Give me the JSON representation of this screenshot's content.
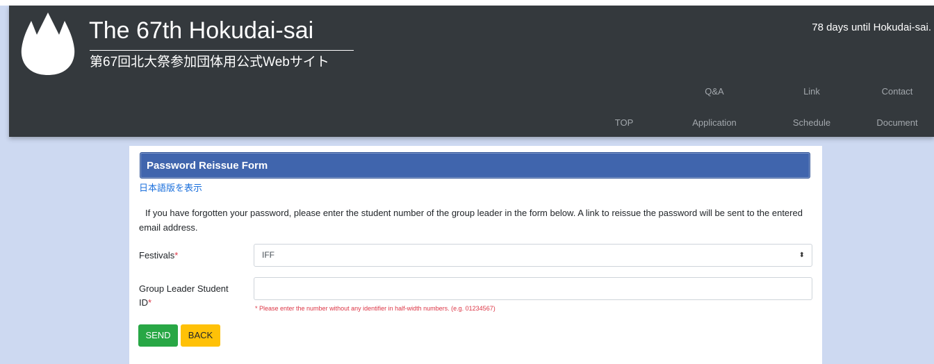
{
  "header": {
    "title": "The 67th Hokudai-sai",
    "subtitle": "第67回北大祭参加団体用公式Webサイト",
    "countdown": "78 days until Hokudai-sai.",
    "logo_icon": "white-flame-leaf-logo"
  },
  "nav": {
    "row1": [
      "Q&A",
      "Link",
      "Contact"
    ],
    "row2": [
      "TOP",
      "Application",
      "Schedule",
      "Document"
    ]
  },
  "form": {
    "title": "Password Reissue Form",
    "lang_link": "日本語版を表示",
    "intro": "If you have forgotten your password, please enter the student number of the group leader in the form below. A link to reissue the password will be sent to the entered email address.",
    "festivals_label": "Festivals",
    "festivals_value": "IFF",
    "student_id_label": "Group Leader Student ID",
    "required_mark": "*",
    "student_id_value": "",
    "hint": "* Please enter the number without any identifier in half-width numbers. (e.g. 01234567)",
    "send_label": "SEND",
    "back_label": "BACK"
  },
  "colors": {
    "header_bg": "#34393d",
    "page_bg": "#cdd9f1",
    "form_header_bg": "#4065ad",
    "send_button": "#28a745",
    "back_button": "#ffc107",
    "required": "#dc3545",
    "link": "#1a6fdc"
  }
}
